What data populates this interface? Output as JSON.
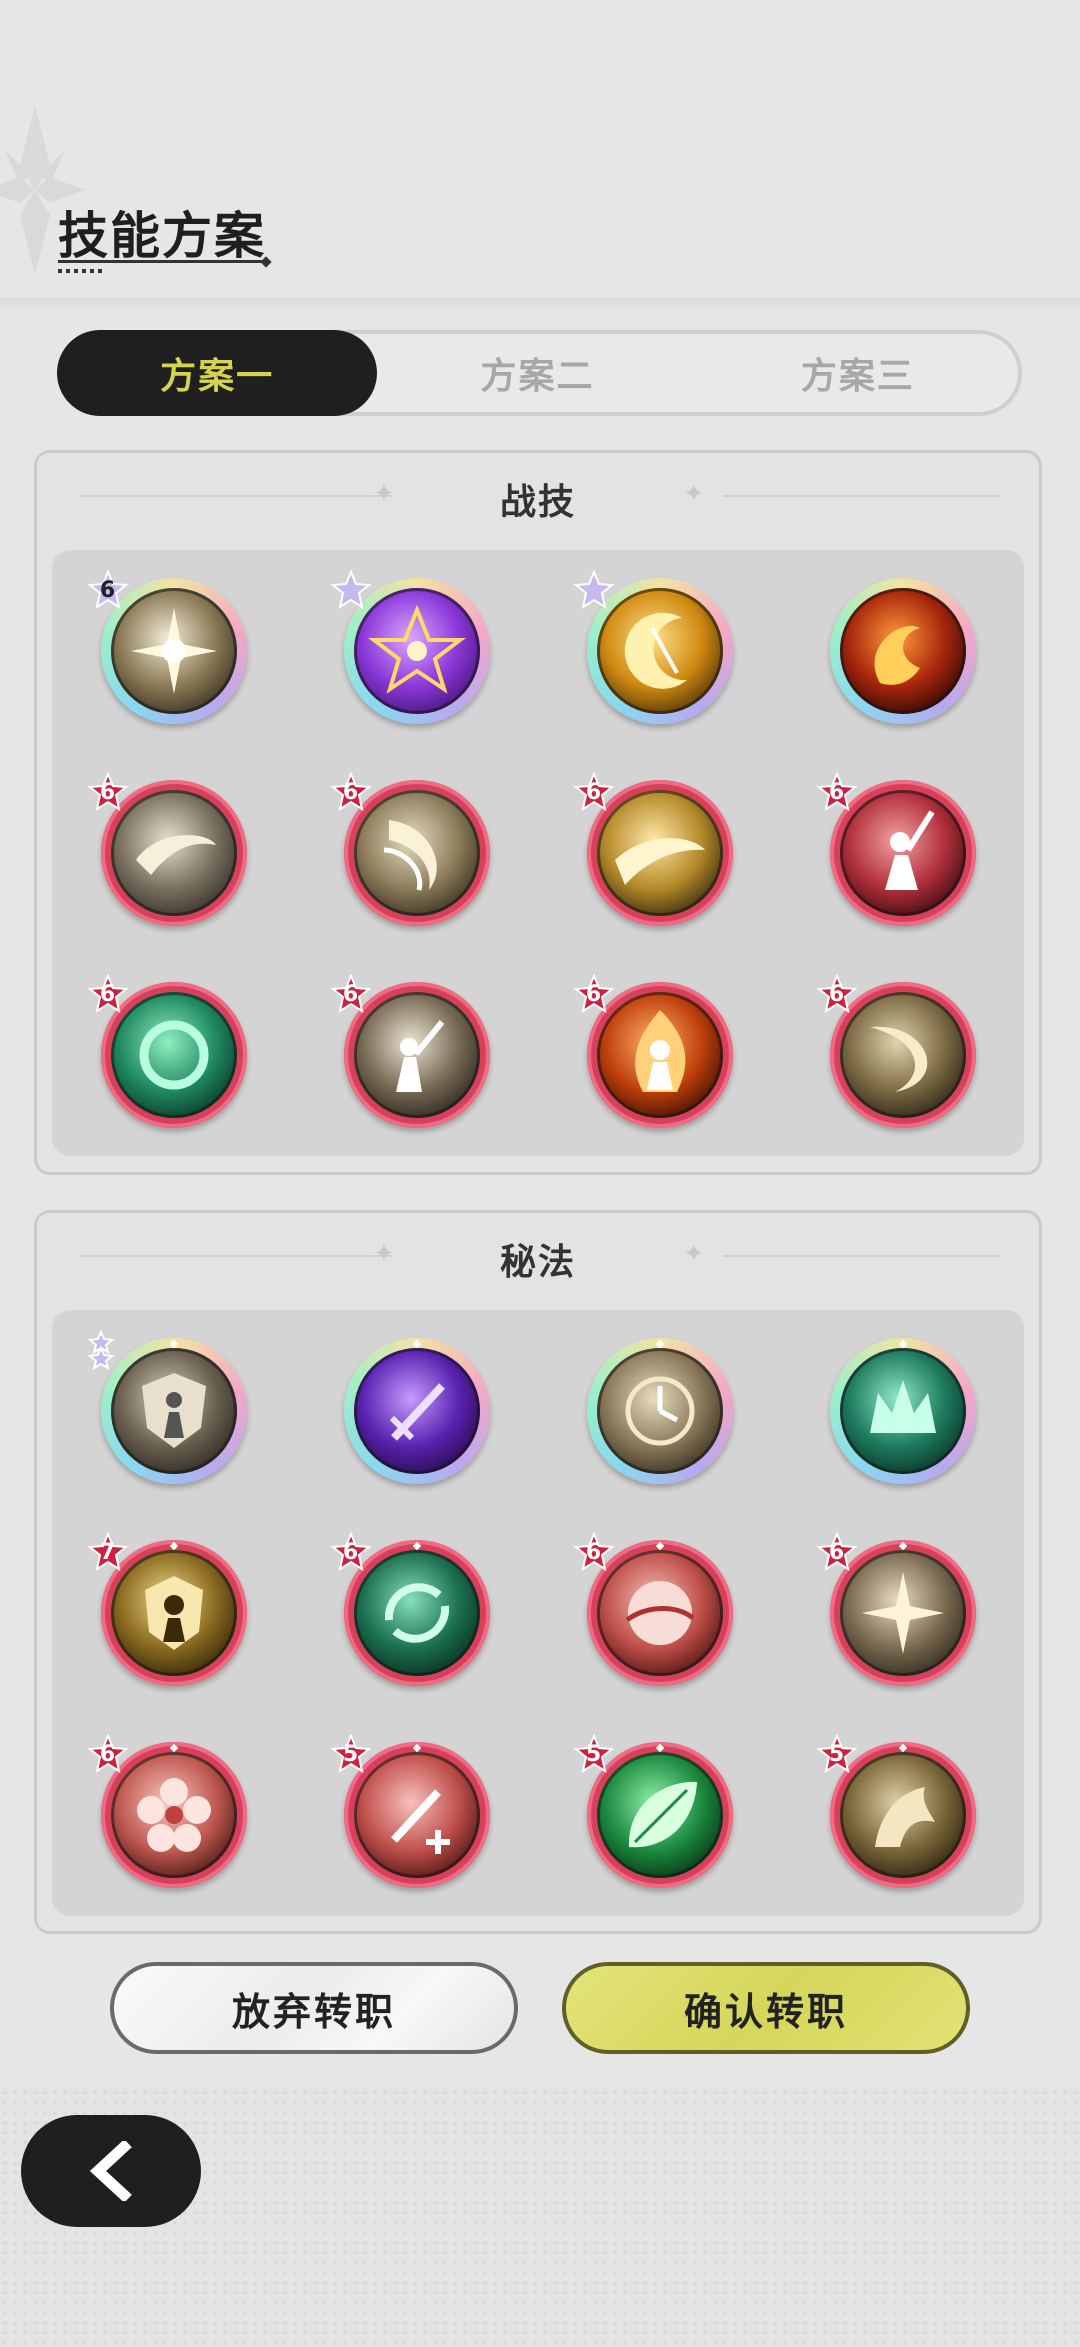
{
  "header": {
    "title": "技能方案"
  },
  "tabs": [
    {
      "label": "方案一",
      "active": true
    },
    {
      "label": "方案二",
      "active": false
    },
    {
      "label": "方案三",
      "active": false
    }
  ],
  "sections": [
    {
      "title": "战技",
      "skills": [
        {
          "icon": "radiant-burst-icon",
          "rarity": "rainbow",
          "badge": "6",
          "badge_type": "star-number"
        },
        {
          "icon": "purple-star-seal-icon",
          "rarity": "rainbow",
          "badge": "",
          "badge_type": "star-only"
        },
        {
          "icon": "golden-crescent-icon",
          "rarity": "rainbow",
          "badge": "",
          "badge_type": "star-only"
        },
        {
          "icon": "fire-swirl-icon",
          "rarity": "rainbow",
          "badge": "",
          "badge_type": "none"
        },
        {
          "icon": "wind-slash-icon",
          "rarity": "red",
          "badge": "6",
          "badge_type": "red-star"
        },
        {
          "icon": "cyclone-icon",
          "rarity": "red",
          "badge": "6",
          "badge_type": "red-star"
        },
        {
          "icon": "golden-slash-icon",
          "rarity": "red",
          "badge": "6",
          "badge_type": "red-star"
        },
        {
          "icon": "sword-raise-icon",
          "rarity": "red",
          "badge": "6",
          "badge_type": "red-star"
        },
        {
          "icon": "jade-ring-icon",
          "rarity": "red",
          "badge": "6",
          "badge_type": "red-star"
        },
        {
          "icon": "uppercut-icon",
          "rarity": "red",
          "badge": "6",
          "badge_type": "red-star"
        },
        {
          "icon": "flame-figure-icon",
          "rarity": "red",
          "badge": "6",
          "badge_type": "red-star"
        },
        {
          "icon": "crescent-wave-icon",
          "rarity": "red",
          "badge": "6",
          "badge_type": "red-star"
        }
      ]
    },
    {
      "title": "秘法",
      "skills": [
        {
          "icon": "shield-figure-icon",
          "rarity": "rainbow",
          "badge": "",
          "badge_type": "double-star"
        },
        {
          "icon": "purple-sword-icon",
          "rarity": "rainbow",
          "badge": "",
          "badge_type": "none"
        },
        {
          "icon": "clock-icon",
          "rarity": "rainbow",
          "badge": "",
          "badge_type": "none"
        },
        {
          "icon": "green-crown-icon",
          "rarity": "rainbow",
          "badge": "",
          "badge_type": "none"
        },
        {
          "icon": "golden-guard-icon",
          "rarity": "red",
          "badge": "7",
          "badge_type": "red-star"
        },
        {
          "icon": "green-cycle-icon",
          "rarity": "red",
          "badge": "6",
          "badge_type": "red-star"
        },
        {
          "icon": "red-moon-icon",
          "rarity": "red",
          "badge": "6",
          "badge_type": "red-star"
        },
        {
          "icon": "compass-star-icon",
          "rarity": "red",
          "badge": "6",
          "badge_type": "red-star"
        },
        {
          "icon": "blossom-icon",
          "rarity": "red",
          "badge": "6",
          "badge_type": "red-star"
        },
        {
          "icon": "sword-heal-icon",
          "rarity": "red",
          "badge": "5",
          "badge_type": "red-star"
        },
        {
          "icon": "green-leaf-icon",
          "rarity": "red",
          "badge": "5",
          "badge_type": "red-star"
        },
        {
          "icon": "dragon-icon",
          "rarity": "red",
          "badge": "5",
          "badge_type": "red-star"
        }
      ]
    }
  ],
  "actions": {
    "abandon_label": "放弃转职",
    "confirm_label": "确认转职"
  },
  "colors": {
    "accent": "#d6d44f",
    "dark": "#1f1f1f",
    "red_ring": "#d6405a",
    "confirm_bg": "#d5d65a"
  }
}
